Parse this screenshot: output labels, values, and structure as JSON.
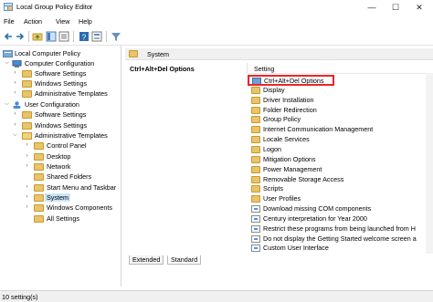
{
  "window": {
    "title": "Local Group Policy Editor",
    "minimize": "—",
    "maximize": "☐",
    "close": "✕"
  },
  "menu": [
    "File",
    "Action",
    "View",
    "Help"
  ],
  "toolbar": {
    "icons": [
      "back-arrow-icon",
      "forward-arrow-icon",
      "up-folder-icon",
      "show-tree-icon",
      "export-list-icon",
      "help-icon",
      "properties-icon",
      "filter-icon"
    ]
  },
  "tree": {
    "root": "Local Computer Policy",
    "computer_config": "Computer Configuration",
    "cc_software": "Software Settings",
    "cc_windows": "Windows Settings",
    "cc_admin": "Administrative Templates",
    "user_config": "User Configuration",
    "uc_software": "Software Settings",
    "uc_windows": "Windows Settings",
    "uc_admin": "Administrative Templates",
    "control_panel": "Control Panel",
    "desktop": "Desktop",
    "network": "Network",
    "shared_folders": "Shared Folders",
    "start_menu": "Start Menu and Taskbar",
    "system": "System",
    "windows_components": "Windows Components",
    "all_settings": "All Settings"
  },
  "right": {
    "header": "System",
    "detail_title": "Ctrl+Alt+Del Options",
    "column": "Setting",
    "rows": [
      {
        "label": "Ctrl+Alt+Del Options",
        "type": "selected"
      },
      {
        "label": "Display",
        "type": "folder"
      },
      {
        "label": "Driver Installation",
        "type": "folder"
      },
      {
        "label": "Folder Redirection",
        "type": "folder"
      },
      {
        "label": "Group Policy",
        "type": "folder"
      },
      {
        "label": "Internet Communication Management",
        "type": "folder"
      },
      {
        "label": "Locale Services",
        "type": "folder"
      },
      {
        "label": "Logon",
        "type": "folder"
      },
      {
        "label": "Mitigation Options",
        "type": "folder"
      },
      {
        "label": "Power Management",
        "type": "folder"
      },
      {
        "label": "Removable Storage Access",
        "type": "folder"
      },
      {
        "label": "Scripts",
        "type": "folder"
      },
      {
        "label": "User Profiles",
        "type": "folder"
      },
      {
        "label": "Download missing COM components",
        "type": "setting"
      },
      {
        "label": "Century interpretation for Year 2000",
        "type": "setting"
      },
      {
        "label": "Restrict these programs from being launched from H",
        "type": "setting"
      },
      {
        "label": "Do not display the Getting Started welcome screen a",
        "type": "setting"
      },
      {
        "label": "Custom User Interface",
        "type": "setting"
      }
    ]
  },
  "tabs": [
    "Extended",
    "Standard"
  ],
  "status": "10 setting(s)",
  "colors": {
    "highlight_border": "#e8262a",
    "selection": "#cce4f7",
    "folder": "#e9c46a"
  }
}
